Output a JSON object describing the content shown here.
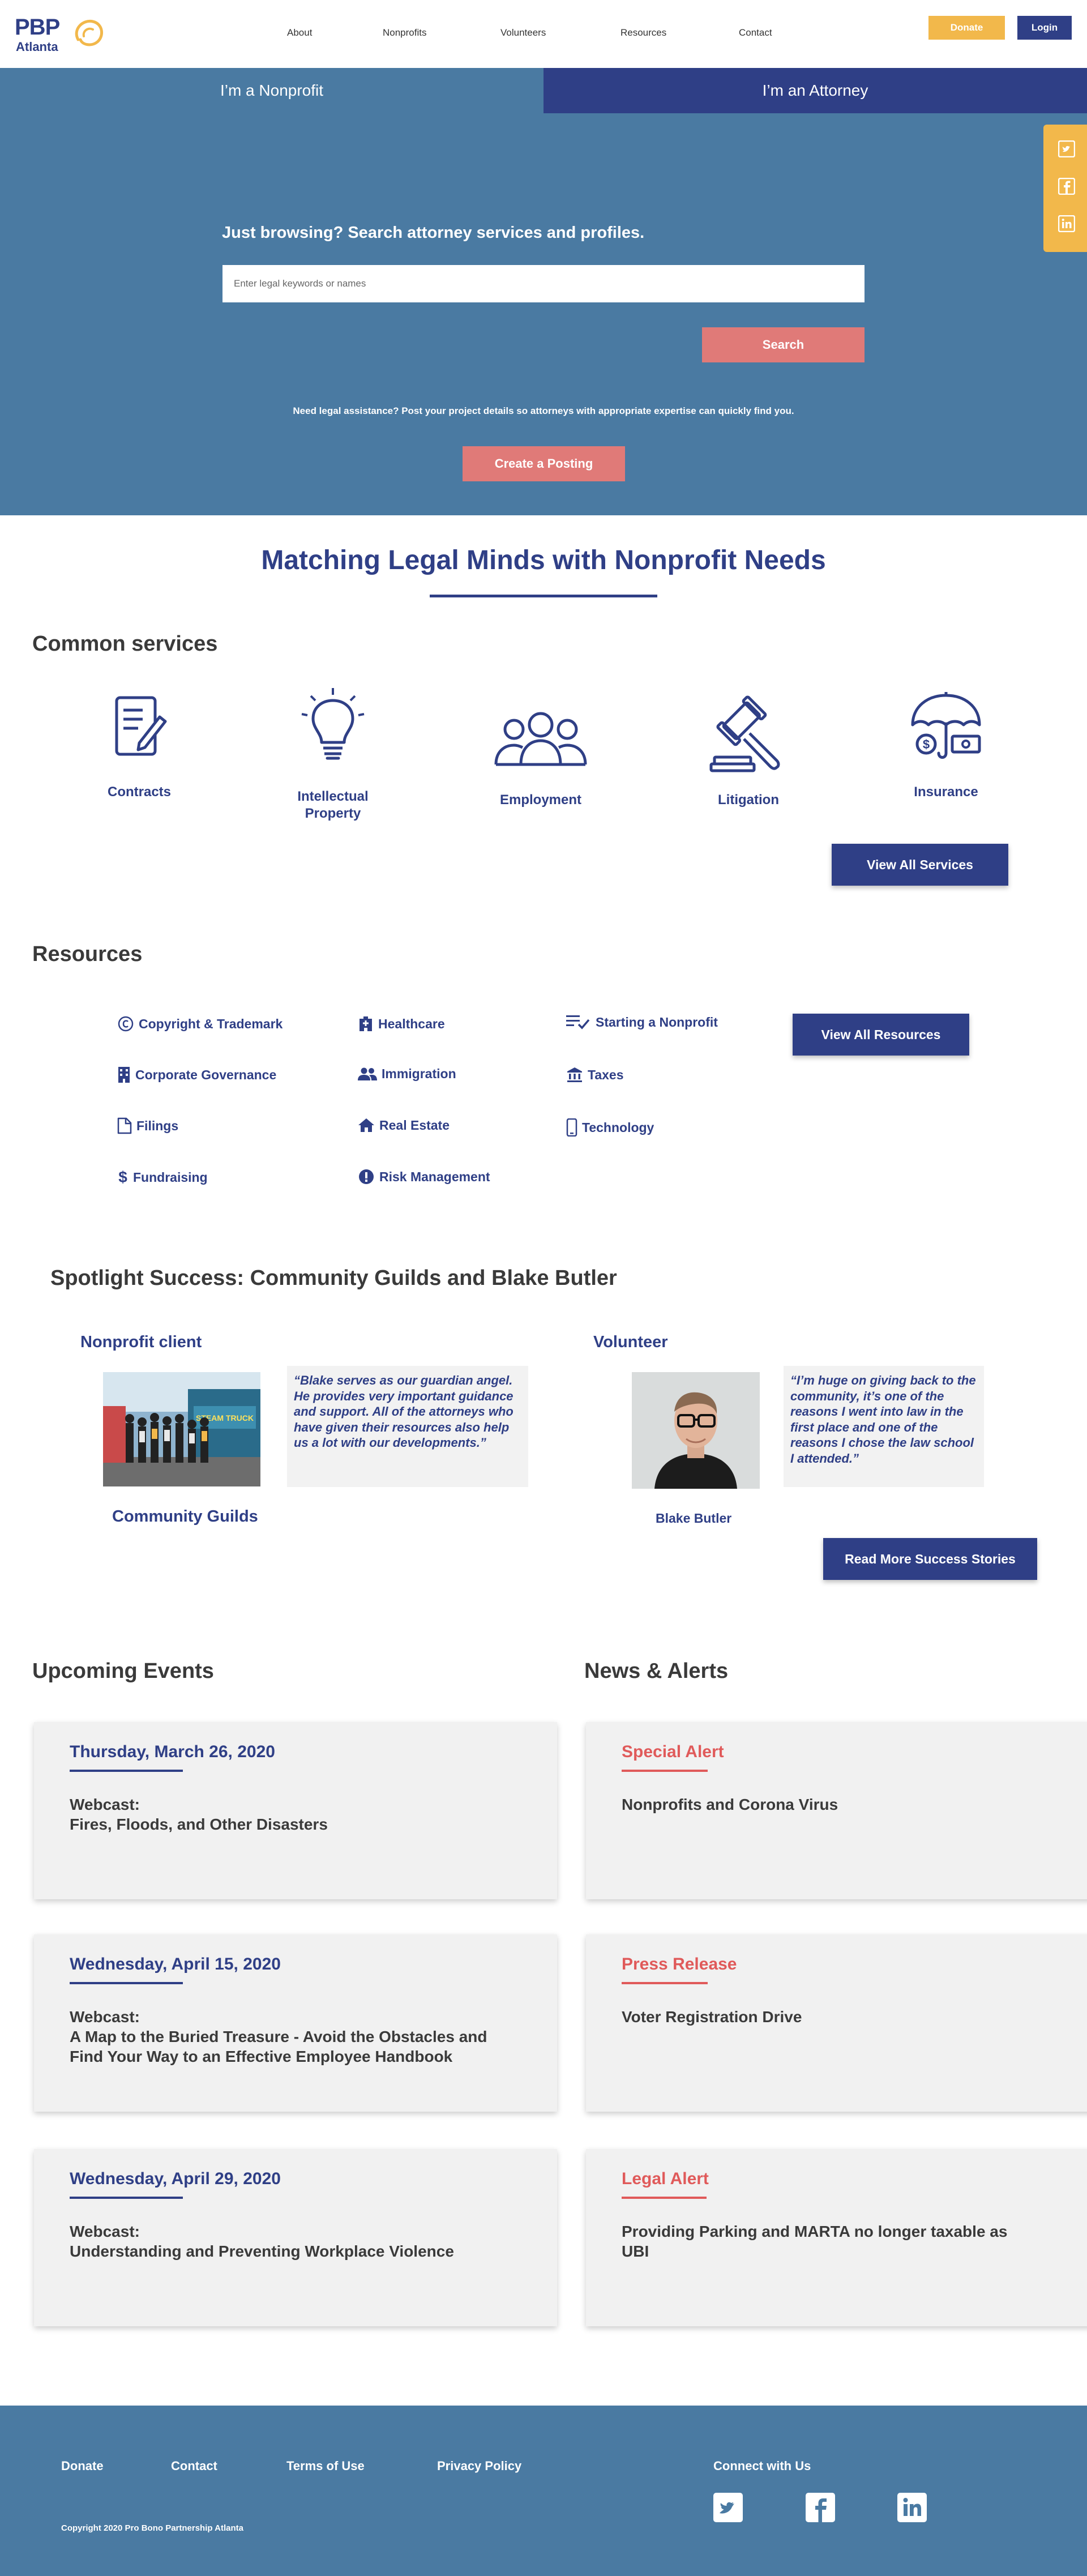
{
  "header": {
    "logo_main": "PBP",
    "logo_sub": "Atlanta",
    "nav": [
      "About",
      "Nonprofits",
      "Volunteers",
      "Resources",
      "Contact"
    ],
    "donate_label": "Donate",
    "login_label": "Login"
  },
  "hero": {
    "tab_nonprofit": "I’m a Nonprofit",
    "tab_attorney": "I’m an Attorney",
    "search_title": "Just browsing? Search attorney services and profiles.",
    "search_placeholder": "Enter legal keywords or names",
    "search_button": "Search",
    "note": "Need legal assistance? Post your project details so attorneys with appropriate expertise can quickly find you.",
    "posting_button": "Create a Posting"
  },
  "side_social": [
    "twitter-icon",
    "facebook-icon",
    "linkedin-icon"
  ],
  "main_title": "Matching Legal Minds with Nonprofit Needs",
  "services": {
    "heading": "Common services",
    "items": [
      {
        "label": "Contracts",
        "icon": "contract-icon"
      },
      {
        "label": "Intellectual Property",
        "icon": "lightbulb-icon"
      },
      {
        "label": "Employment",
        "icon": "people-icon"
      },
      {
        "label": "Litigation",
        "icon": "gavel-icon"
      },
      {
        "label": "Insurance",
        "icon": "umbrella-icon"
      }
    ],
    "view_all": "View All Services"
  },
  "resources": {
    "heading": "Resources",
    "items": [
      {
        "label": "Copyright & Trademark",
        "icon": "copyright-icon"
      },
      {
        "label": "Healthcare",
        "icon": "hospital-icon"
      },
      {
        "label": "Starting a Nonprofit",
        "icon": "checklist-icon"
      },
      {
        "label": "Corporate Governance",
        "icon": "building-icon"
      },
      {
        "label": "Immigration",
        "icon": "people-icon"
      },
      {
        "label": "Taxes",
        "icon": "bank-icon"
      },
      {
        "label": "Filings",
        "icon": "file-icon"
      },
      {
        "label": "Real Estate",
        "icon": "house-icon"
      },
      {
        "label": "Technology",
        "icon": "phone-icon"
      },
      {
        "label": "Fundraising",
        "icon": "dollar-icon"
      },
      {
        "label": "Risk Management",
        "icon": "alert-icon"
      }
    ],
    "view_all": "View All Resources"
  },
  "spotlight": {
    "heading": "Spotlight Success: Community Guilds and Blake Butler",
    "nonprofit_sub": "Nonprofit client",
    "nonprofit_quote": "“Blake serves as our guardian angel. He provides very important guidance and support. All of the attorneys who have given their resources also help us a lot with our developments.”",
    "nonprofit_name": "Community Guilds",
    "photo_caption": "STEAM TRUCK",
    "volunteer_sub": "Volunteer",
    "volunteer_quote": "“I’m huge on giving back to the community, it’s one of the reasons I went into law in the first place and one of the reasons I chose the law school I attended.”",
    "volunteer_name": "Blake Butler",
    "read_more": "Read More Success Stories"
  },
  "events": {
    "heading": "Upcoming Events",
    "items": [
      {
        "date": "Thursday, March 26, 2020",
        "type": "Webcast:",
        "title": "Fires, Floods, and Other Disasters"
      },
      {
        "date": "Wednesday, April 15, 2020",
        "type": "Webcast:",
        "title": "A Map to the Buried Treasure - Avoid the Obstacles and Find Your Way to an Effective Employee Handbook"
      },
      {
        "date": "Wednesday, April 29, 2020",
        "type": "Webcast:",
        "title": "Understanding and Preventing Workplace Violence"
      }
    ]
  },
  "news": {
    "heading": "News & Alerts",
    "items": [
      {
        "tag": "Special Alert",
        "title": "Nonprofits and Corona Virus"
      },
      {
        "tag": "Press Release",
        "title": "Voter Registration Drive"
      },
      {
        "tag": "Legal Alert",
        "title": "Providing Parking and MARTA no longer taxable as UBI"
      }
    ]
  },
  "footer": {
    "links": [
      "Donate",
      "Contact",
      "Terms of Use",
      "Privacy Policy"
    ],
    "connect": "Connect with Us",
    "copyright": "Copyright 2020 Pro Bono Partnership Atlanta",
    "social": [
      "twitter-icon",
      "facebook-icon",
      "linkedin-icon"
    ]
  },
  "colors": {
    "navy": "#2f3f86",
    "steel_blue": "#4a7aa2",
    "coral": "#e07a78",
    "gold": "#f2b84b",
    "alert_red": "#e05a5a"
  }
}
